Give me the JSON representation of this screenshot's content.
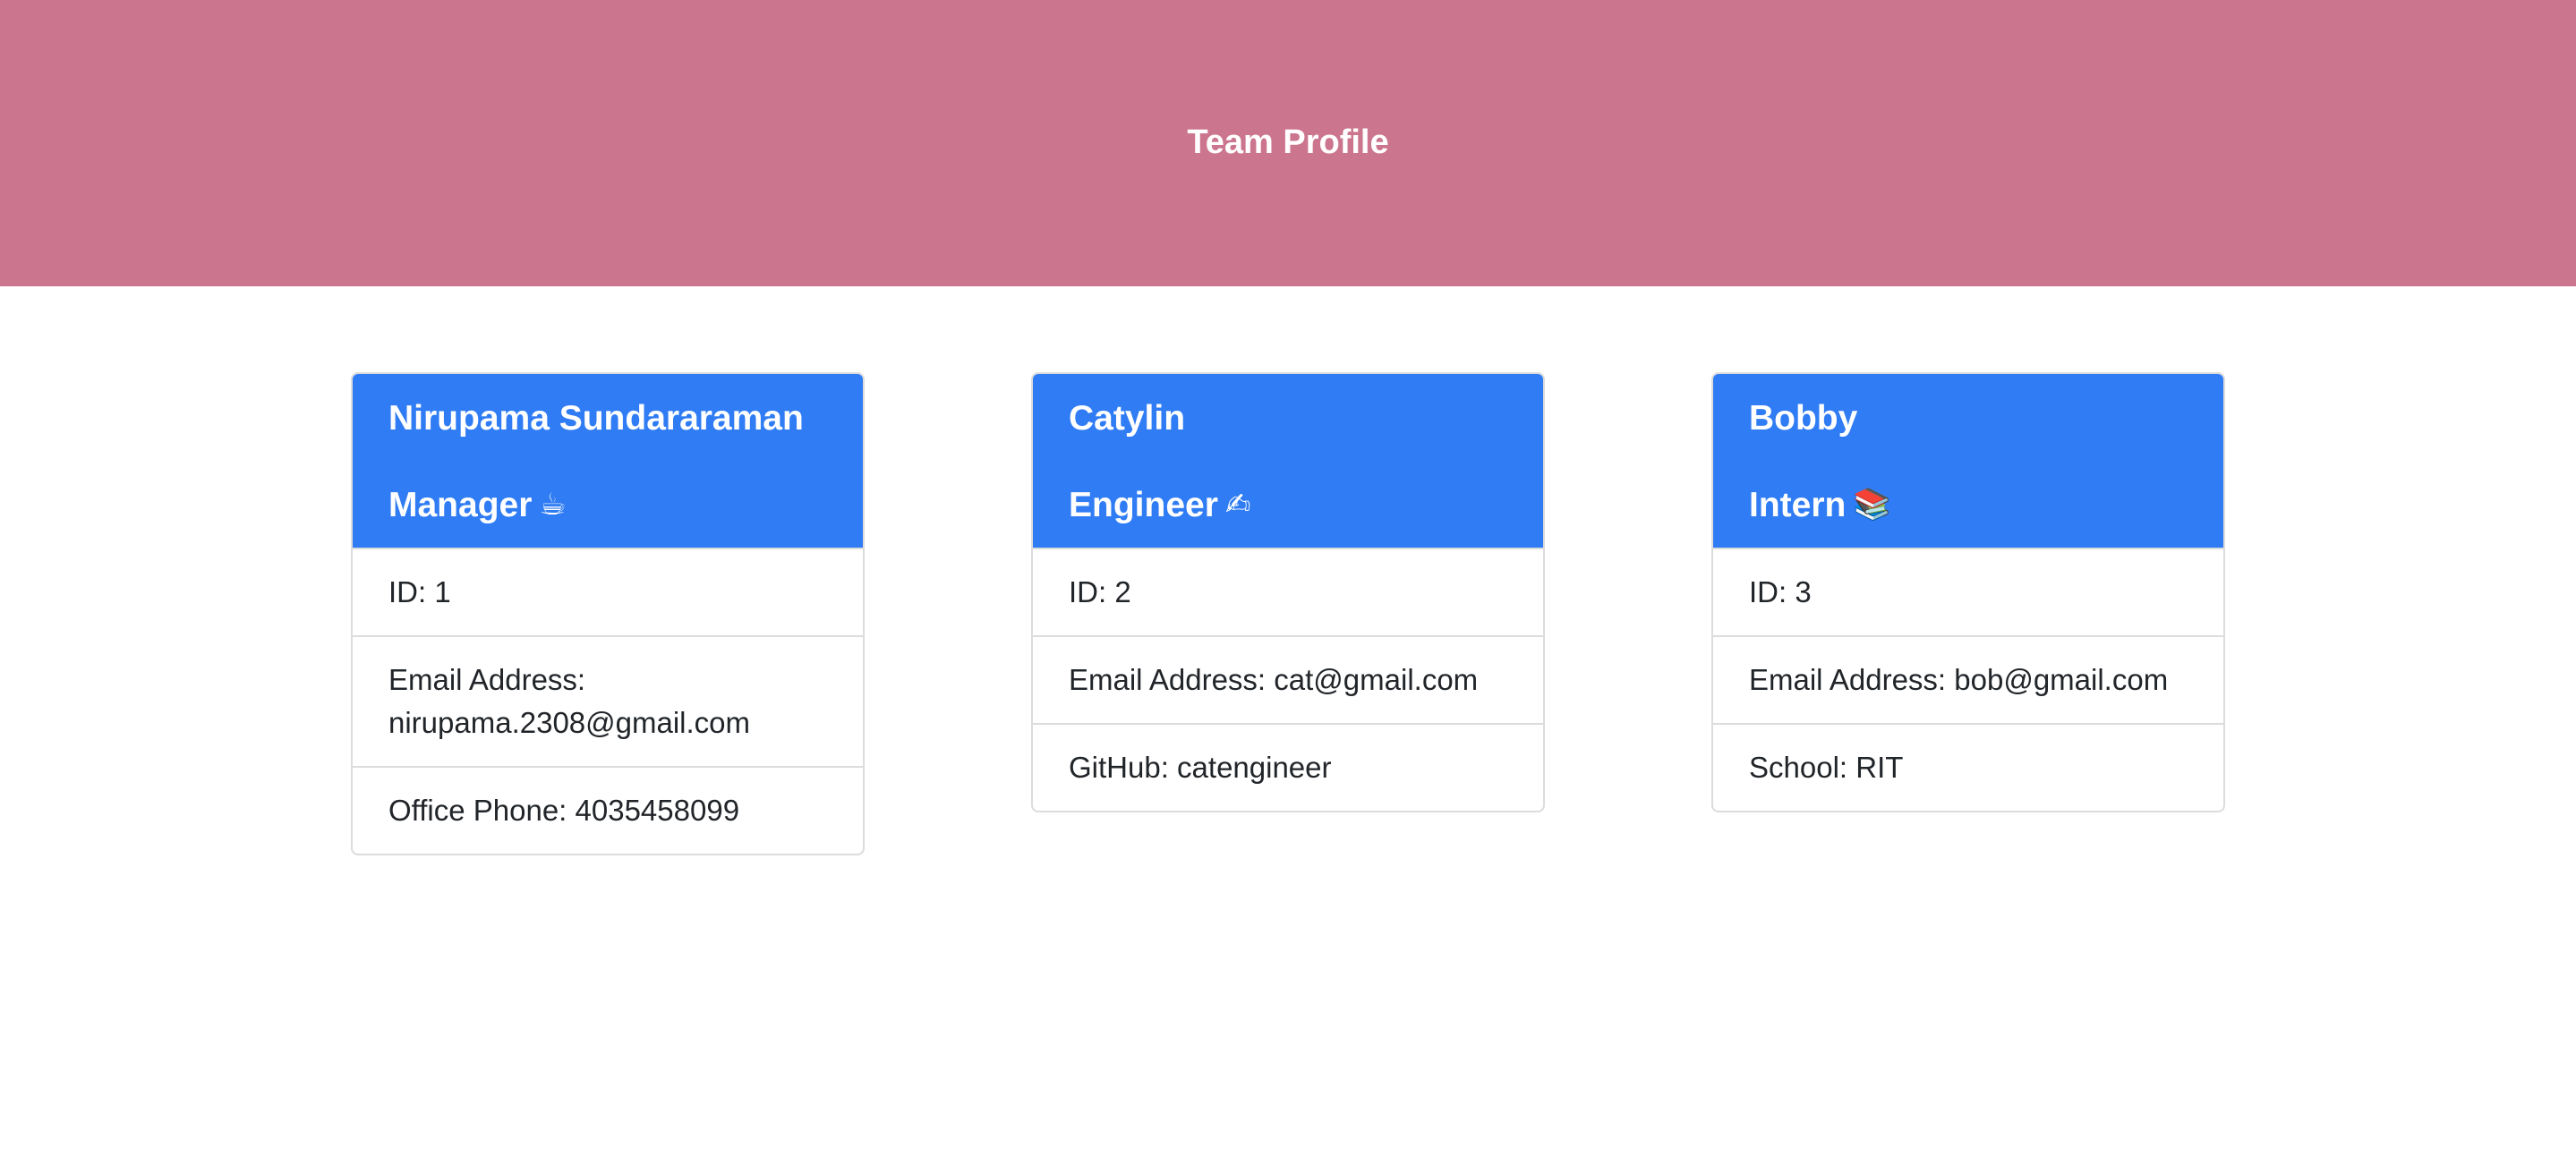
{
  "header": {
    "title": "Team Profile"
  },
  "colors": {
    "header_bg": "#cc758e",
    "card_header_bg": "#2f7cf4"
  },
  "cards": [
    {
      "name": "Nirupama Sundararaman",
      "role": "Manager",
      "role_icon": "☕",
      "role_icon_name": "coffee-icon",
      "id_label": "ID: 1",
      "email_label": "Email Address:",
      "email": "nirupama.2308@gmail.com",
      "extra_label": "Office Phone: 4035458099"
    },
    {
      "name": "Catylin",
      "role": "Engineer",
      "role_icon": "✍",
      "role_icon_name": "writing-hand-icon",
      "id_label": "ID: 2",
      "email_label": "Email Address:",
      "email": "cat@gmail.com",
      "extra_label": "GitHub: catengineer"
    },
    {
      "name": "Bobby",
      "role": "Intern",
      "role_icon": "📚",
      "role_icon_name": "books-icon",
      "id_label": "ID: 3",
      "email_label": "Email Address:",
      "email": "bob@gmail.com",
      "extra_label": "School: RIT"
    }
  ]
}
